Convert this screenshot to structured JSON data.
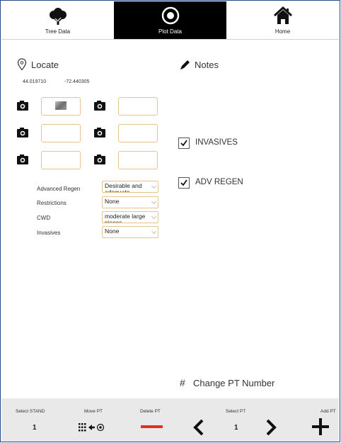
{
  "tabs": [
    {
      "label": "Tree Data",
      "icon": "tree-icon"
    },
    {
      "label": "Plot Data",
      "icon": "target-icon"
    },
    {
      "label": "Home",
      "icon": "home-icon"
    }
  ],
  "locate": {
    "label": "Locate",
    "latitude": "44.019710",
    "longitude": "-72.440305"
  },
  "notes": {
    "label": "Notes"
  },
  "form": {
    "fields": [
      {
        "label": "Advanced Regen",
        "value": "Desirable and adequate"
      },
      {
        "label": "Restrictions",
        "value": "None"
      },
      {
        "label": "CWD",
        "value": "moderate large pieces"
      },
      {
        "label": "Invasives",
        "value": "None"
      }
    ]
  },
  "checks": [
    {
      "label": "INVASIVES",
      "checked": true
    },
    {
      "label": "ADV REGEN",
      "checked": true
    }
  ],
  "change_pt": {
    "label": "Change PT Number",
    "icon": "hash-icon"
  },
  "bottom": {
    "select_stand": {
      "label": "Select STAND",
      "value": "1"
    },
    "move_pt": {
      "label": "Move PT"
    },
    "delete_pt": {
      "label": "Delete PT"
    },
    "select_pt": {
      "label": "Select PT",
      "value": "1"
    },
    "add_pt": {
      "label": "Add PT"
    }
  },
  "colors": {
    "accent_red": "#e1301e",
    "active_tab": "#000000",
    "field_border": "#e6c58c",
    "frame": "#2b4a8a"
  }
}
